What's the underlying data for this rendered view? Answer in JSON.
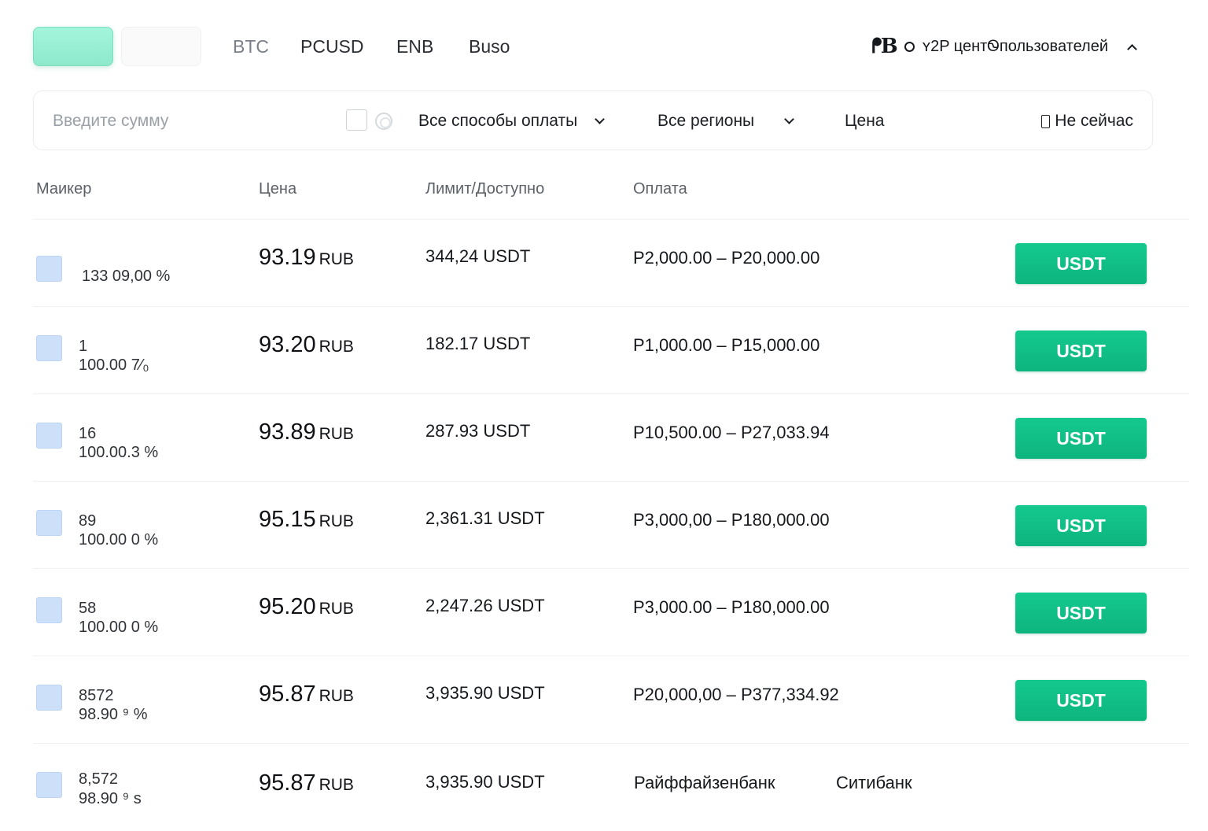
{
  "tabs": {
    "coins": [
      "BTC",
      "PCUSD",
      "ENB",
      "Buso"
    ]
  },
  "user_center": {
    "logo": "ᖰB",
    "label": "ʏ2P центᏫпользователей"
  },
  "filters": {
    "amount_placeholder": "Введите сумму",
    "payment_methods": "Все способы оплаты",
    "regions": "Все регионы",
    "price": "Цена",
    "not_now": "Не сейчас"
  },
  "table": {
    "headers": {
      "maker": "Маикер",
      "price": "Цена",
      "limit": "Лимит/Доступно",
      "payment": "Оплата"
    },
    "rows": [
      {
        "orders": "133  09,00 %",
        "rate": "",
        "price": "93.19",
        "currency": "RUB",
        "available": "344,24 USDT",
        "limits": "P2,000.00 – P20,000.00",
        "button": "USDT"
      },
      {
        "orders": "1",
        "rate": "100.00 7⁄₀",
        "price": "93.20",
        "currency": "RUB",
        "available": "182.17 USDT",
        "limits": "P1,000.00 – P15,000.00",
        "button": "USDT"
      },
      {
        "orders": "16",
        "rate": "100.00.3 %",
        "price": "93.89",
        "currency": "RUB",
        "available": "287.93 USDT",
        "limits": "P10,500.00 – P27,033.94",
        "button": "USDT"
      },
      {
        "orders": "89",
        "rate": "100.00 0 %",
        "price": "95.15",
        "currency": "RUB",
        "available": "2,361.31 USDT",
        "limits": "P3,000,00 – P180,000.00",
        "button": "USDT"
      },
      {
        "orders": "58",
        "rate": "100.00 0 %",
        "price": "95.20",
        "currency": "RUB",
        "available": "2,247.26 USDT",
        "limits": "P3,000.00 – P180,000.00",
        "button": "USDT"
      },
      {
        "orders": "8572",
        "rate": "98.90 ⁹ %",
        "price": "95.87",
        "currency": "RUB",
        "available": "3,935.90 USDT",
        "limits": "P20,000,00 – P377,334.92",
        "button": "USDT"
      },
      {
        "orders": "8,572",
        "rate": "98.90 ⁹ ѕ",
        "price": "95.87",
        "currency": "RUB",
        "available": "3,935.90 USDT",
        "payment_methods": [
          "Райффайзенбанк",
          "Ситибанк"
        ]
      }
    ]
  },
  "colors": {
    "accent_green": "#0db57e",
    "active_tab_mint": "#9ef0d6",
    "avatar_blue": "#cde0fa"
  },
  "icons": {
    "phone": "phone-icon",
    "caret": "chevron-down-icon",
    "refresh": "refresh-icon",
    "collapse": "chevron-up-icon"
  }
}
